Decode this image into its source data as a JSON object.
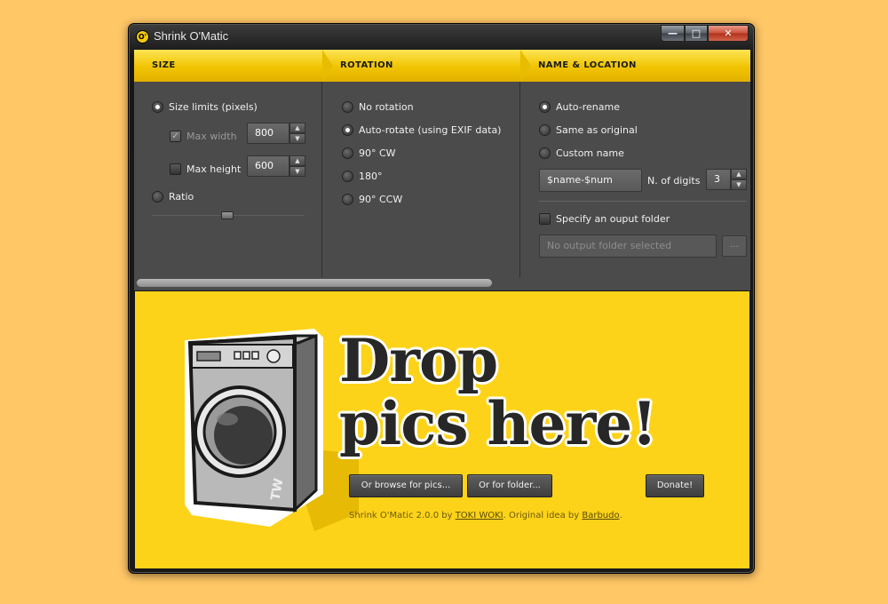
{
  "window": {
    "title": "Shrink O'Matic",
    "icon_letters": "O'",
    "controls": {
      "minimize": "—",
      "maximize": "□",
      "close": "✕"
    }
  },
  "header": {
    "size_tab": "SIZE",
    "rotation_tab": "ROTATION",
    "name_location_tab": "NAME & LOCATION"
  },
  "size": {
    "size_limits_label": "Size limits (pixels)",
    "size_limits_selected": true,
    "max_width_label": "Max width",
    "max_width_checked": true,
    "max_width_value": "800",
    "max_height_label": "Max height",
    "max_height_checked": false,
    "max_height_value": "600",
    "ratio_label": "Ratio",
    "ratio_selected": false,
    "ratio_slider_position": 0.5
  },
  "rotation": {
    "options": [
      {
        "label": "No rotation",
        "selected": false
      },
      {
        "label": "Auto-rotate (using EXIF data)",
        "selected": true
      },
      {
        "label": "90° CW",
        "selected": false
      },
      {
        "label": "180°",
        "selected": false
      },
      {
        "label": "90° CCW",
        "selected": false
      }
    ]
  },
  "naming": {
    "options": [
      {
        "label": "Auto-rename",
        "selected": true
      },
      {
        "label": "Same as original",
        "selected": false
      },
      {
        "label": "Custom name",
        "selected": false
      }
    ],
    "name_pattern": "$name-$num",
    "digits_label": "N. of digits",
    "digits_value": "3",
    "output_folder_label": "Specify an ouput folder",
    "output_folder_checked": false,
    "output_folder_placeholder": "No output folder selected",
    "browse_folder_button": "..."
  },
  "drop": {
    "line1": "Drop",
    "line2": "pics here!",
    "browse_pics_button": "Or browse for pics...",
    "browse_folder_button": "Or for folder...",
    "donate_button": "Donate!",
    "credits_prefix": "Shrink O'Matic 2.0.0 by ",
    "credits_author": "TOKI WOKI",
    "credits_middle": ". Original idea by ",
    "credits_idea": "Barbudo",
    "credits_suffix": ".",
    "machine_badge": "TW"
  },
  "colors": {
    "accent_yellow": "#fdd319",
    "panel_gray": "#4b4b4b",
    "background": "#ffc766"
  }
}
